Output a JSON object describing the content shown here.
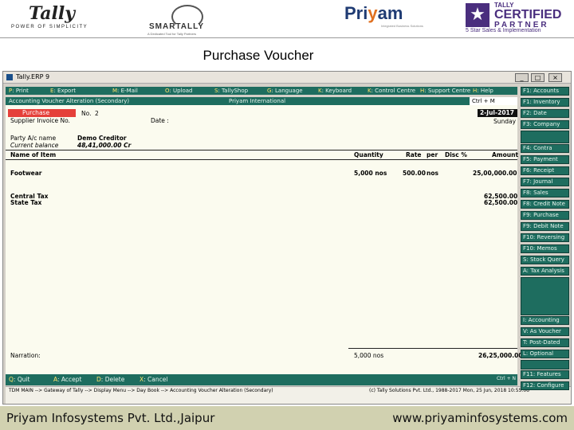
{
  "logos": {
    "tally_word": "Tally",
    "tally_tag": "POWER OF SIMPLICITY",
    "smartally_word": "SMARTALLY",
    "smartally_tag": "A Dedicated Tool for Tally Partners",
    "priyam_word_1": "Pri",
    "priyam_word_2": "y",
    "priyam_word_3": "am",
    "priyam_tag": "Integrated Business Solutions",
    "cert_line1": "TALLY",
    "cert_line2": "CERTIFIED",
    "cert_line3": "PARTNER",
    "cert_sub": "5 Star Sales & Implementation"
  },
  "slide_title": "Purchase Voucher",
  "window": {
    "title": "Tally.ERP 9",
    "buttons": [
      "_",
      "□",
      "×"
    ]
  },
  "menu": [
    {
      "key": "P",
      "label": ": Print"
    },
    {
      "key": "E",
      "label": ": Export"
    },
    {
      "key": "M",
      "label": ": E-Mail"
    },
    {
      "key": "O",
      "label": ": Upload"
    },
    {
      "key": "S",
      "label": ": TallyShop"
    },
    {
      "key": "G",
      "label": ": Language"
    },
    {
      "key": "K",
      "label": ": Keyboard"
    },
    {
      "key": "K",
      "label": ": Control Centre"
    },
    {
      "key": "H",
      "label": ": Support Centre"
    },
    {
      "key": "H",
      "label": ": Help"
    }
  ],
  "header": {
    "screen": "Accounting Voucher Alteration (Secondary)",
    "company": "Priyam International",
    "ctrl": "Ctrl + M"
  },
  "voucher": {
    "type": "Purchase",
    "number_label": "No.",
    "number": "2",
    "date": "2-Jul-2017",
    "day": "Sunday",
    "supplier_invoice_label": "Supplier Invoice No.",
    "date_label": "Date :",
    "party_label": "Party A/c name",
    "party_value": "Demo Creditor",
    "balance_label": "Current balance",
    "balance_value": "48,41,000.00 Cr"
  },
  "table": {
    "headers": {
      "name": "Name of Item",
      "qty": "Quantity",
      "rate": "Rate",
      "per": "per",
      "disc": "Disc %",
      "amount": "Amount"
    },
    "item": {
      "name": "Footwear",
      "qty": "5,000 nos",
      "rate": "500.00",
      "per": "nos",
      "amount": "25,00,000.00"
    },
    "taxes": [
      {
        "name": "Central Tax",
        "amount": "62,500.00"
      },
      {
        "name": "State Tax",
        "amount": "62,500.00"
      }
    ],
    "narration_label": "Narration:",
    "total_qty": "5,000 nos",
    "total_amount": "26,25,000.00"
  },
  "bottom": [
    {
      "key": "Q",
      "label": ": Quit"
    },
    {
      "key": "A",
      "label": ": Accept"
    },
    {
      "key": "D",
      "label": ": Delete"
    },
    {
      "key": "X",
      "label": ": Cancel"
    }
  ],
  "bottom_ctr": "Ctrl + N",
  "status": {
    "path": "TDM MAIN --> Gateway of Tally --> Display Menu --> Day Book --> Accounting Voucher Alteration (Secondary)",
    "right": "(c) Tally Solutions Pvt. Ltd., 1988-2017   Mon, 25 Jun, 2018   10:55:06"
  },
  "rbuttons": {
    "f2_date": "F2: Date",
    "f3_company": "F3: Company",
    "f1_acct": "F1: Accounts",
    "f1_inv": "F1: Inventory",
    "f4_contra": "F4: Contra",
    "f5_payment": "F5: Payment",
    "f6_receipt": "F6: Receipt",
    "f7_journal": "F7: Journal",
    "f8_sales": "F8: Sales",
    "f8c_credit": "F8: Credit Note",
    "f9_purchase": "F9: Purchase",
    "f9d_debit": "F9: Debit Note",
    "f10_reversing": "F10: Reversing",
    "f10_memos": "F10: Memos",
    "s_stock": "S: Stock Query",
    "a_tax": "A: Tax Analysis",
    "i_acct": "I: Accounting",
    "v_voucher": "V: As Voucher",
    "t_postdated": "T: Post-Dated",
    "l_optional": "L: Optional",
    "f11_features": "F11: Features",
    "f12_configure": "F12: Configure"
  },
  "footer": {
    "left": "Priyam Infosystems Pvt. Ltd.,Jaipur",
    "right": "www.priyaminfosystems.com"
  }
}
